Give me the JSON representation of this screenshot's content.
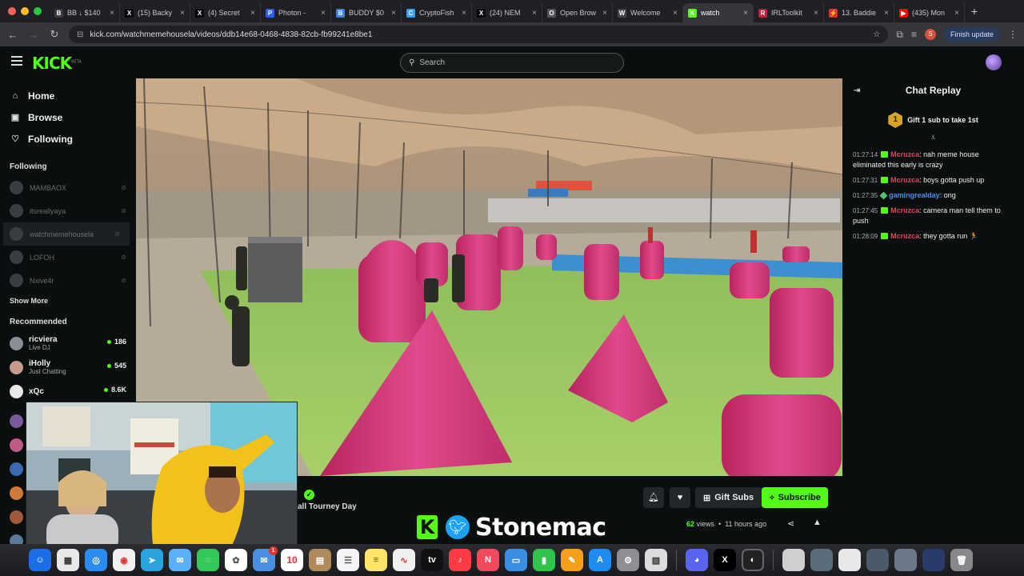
{
  "browser": {
    "tabs": [
      {
        "title": "BB ↓ $140",
        "icon_color": "#3a3a3a",
        "icon_glyph": "B"
      },
      {
        "title": "(15) Backy",
        "icon_color": "#000000",
        "icon_glyph": "X"
      },
      {
        "title": "(4) Secret",
        "icon_color": "#000000",
        "icon_glyph": "X"
      },
      {
        "title": "Photon - ",
        "icon_color": "#2c5cff",
        "icon_glyph": "P"
      },
      {
        "title": "BUDDY $0",
        "icon_color": "#3b82f6",
        "icon_glyph": "B"
      },
      {
        "title": "CryptoFish",
        "icon_color": "#3aa0ff",
        "icon_glyph": "C"
      },
      {
        "title": "(24) NEM",
        "icon_color": "#000000",
        "icon_glyph": "X"
      },
      {
        "title": "Open Brow",
        "icon_color": "#555555",
        "icon_glyph": "O"
      },
      {
        "title": "Welcome",
        "icon_color": "#444444",
        "icon_glyph": "W"
      },
      {
        "title": "watch",
        "icon_color": "#53fc18",
        "icon_glyph": "K",
        "active": true
      },
      {
        "title": "IRLToolkit",
        "icon_color": "#c0203a",
        "icon_glyph": "R"
      },
      {
        "title": "13. Baddie",
        "icon_color": "#e03030",
        "icon_glyph": "⚡"
      },
      {
        "title": "(435) Mon",
        "icon_color": "#ff0000",
        "icon_glyph": "▶"
      }
    ],
    "url": "kick.com/watchmemehousela/videos/ddb14e68-0468-4838-82cb-fb99241e8be1",
    "profile_initial": "S",
    "update_label": "Finish update"
  },
  "header": {
    "logo": "KICK",
    "logo_sup": "BETA",
    "search_placeholder": "Search"
  },
  "sidebar": {
    "nav": [
      {
        "label": "Home",
        "icon": "⌂"
      },
      {
        "label": "Browse",
        "icon": "▣"
      },
      {
        "label": "Following",
        "icon": "♡"
      }
    ],
    "following_title": "Following",
    "following": [
      {
        "name": "MAMBAOX"
      },
      {
        "name": "itsreallyaya"
      },
      {
        "name": "watchmemehousela",
        "selected": true
      },
      {
        "name": "LOFOH"
      },
      {
        "name": "Nxive4r"
      }
    ],
    "show_more": "Show More",
    "recommended_title": "Recommended",
    "recommended": [
      {
        "name": "ricviera",
        "category": "Live DJ",
        "viewers": "186",
        "avatar_color": "#8a8f95"
      },
      {
        "name": "iHolly",
        "category": "Just Chatting",
        "viewers": "545",
        "avatar_color": "#c99a8a"
      },
      {
        "name": "xQc",
        "category": "",
        "viewers": "8.6K",
        "avatar_color": "#e8e8e8"
      }
    ]
  },
  "video_info": {
    "title": "all Tourney Day",
    "gift_subs": "Gift Subs",
    "subscribe": "Subscribe",
    "views_count": "62",
    "views_label": "views",
    "age": "11 hours ago"
  },
  "chat": {
    "title": "Chat Replay",
    "gift_banner": "Gift 1 sub to take 1st",
    "gift_rank": "1",
    "messages": [
      {
        "time": "01:27:14",
        "user": "Mcruzca",
        "user_color": "#e0435a",
        "text": "nah meme house eliminated this early is crazy",
        "badge": "sub"
      },
      {
        "time": "01:27:31",
        "user": "Mcruzca",
        "user_color": "#e0435a",
        "text": "boys gotta push up",
        "badge": "sub"
      },
      {
        "time": "01:27:35",
        "user": "gamingrealday",
        "user_color": "#4a8fe0",
        "text": "ong",
        "badge": "diamond"
      },
      {
        "time": "01:27:45",
        "user": "Mcruzca",
        "user_color": "#e0435a",
        "text": "camera man tell them to push",
        "badge": "sub"
      },
      {
        "time": "01:28:09",
        "user": "Mcruzca",
        "user_color": "#e0435a",
        "text": "they gotta run 🏃",
        "badge": "sub"
      }
    ]
  },
  "watermark": {
    "k": "K",
    "name": "Stonemac"
  },
  "dock": {
    "calendar_day": "10",
    "mail_badge": "1"
  },
  "colors": {
    "kick_green": "#53fc18",
    "background": "#0b0e0f",
    "bunker_pink": "#d9357a"
  }
}
